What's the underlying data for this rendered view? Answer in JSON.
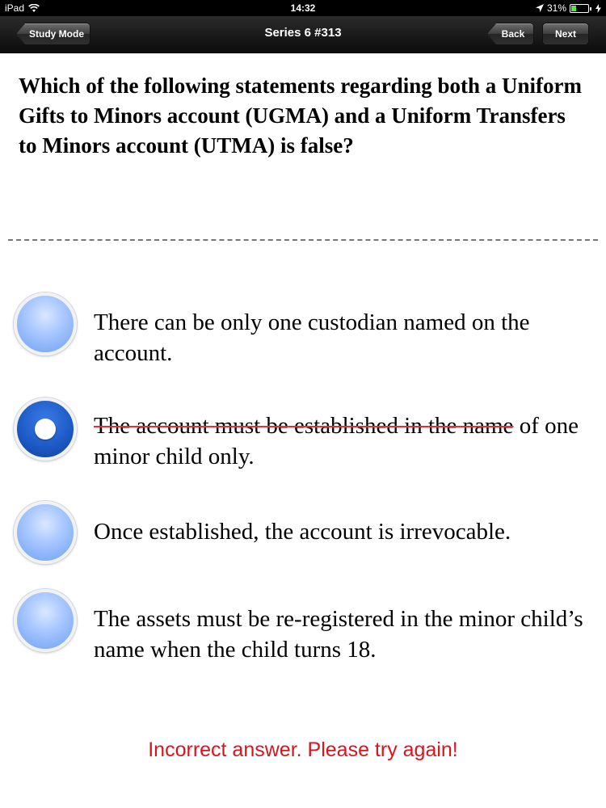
{
  "status_bar": {
    "device": "iPad",
    "time": "14:32",
    "battery": "31%",
    "battery_level": 0.31,
    "icons": [
      "wifi-icon",
      "location-icon",
      "battery-icon",
      "charging-icon"
    ]
  },
  "nav": {
    "title": "Series 6 #313",
    "left_button": "Study Mode",
    "back_button": "Back",
    "next_button": "Next"
  },
  "question": {
    "text": "Which of the following statements regarding both a Uniform Gifts to Minors account (UGMA) and a Uniform Transfers to Minors account (UTMA) is false?"
  },
  "options": [
    {
      "text": "There can be only one custodian named on the account.",
      "selected": false
    },
    {
      "text_struck": "The account must be established in the name",
      "text_rest": " of one minor child only.",
      "selected": true
    },
    {
      "text": "Once established, the account is irrevocable.",
      "selected": false
    },
    {
      "text": "The assets must be re-registered in the minor child’s name when the child turns 18.",
      "selected": false
    }
  ],
  "feedback": {
    "text": "Incorrect answer. Please try again!",
    "color": "#d7151f"
  },
  "colors": {
    "nav_background": "#1a1a1a",
    "radio_unselected": "#8fb6fb",
    "radio_selected": "#1e5bc7",
    "strike_color": "#e0303a"
  }
}
